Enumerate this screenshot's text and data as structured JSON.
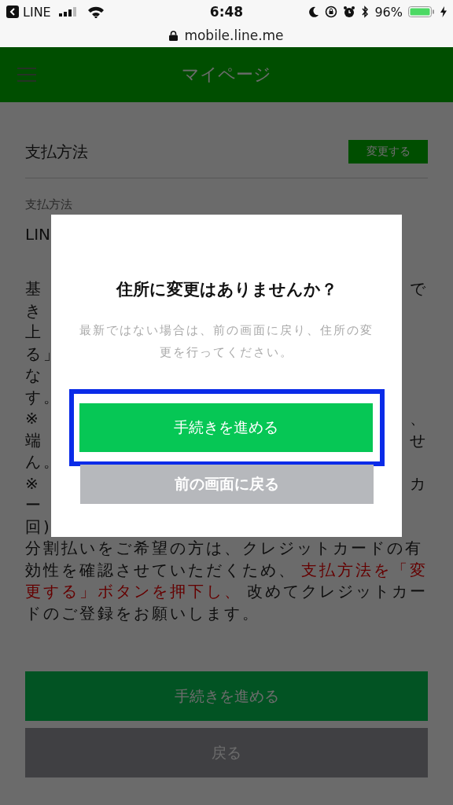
{
  "status_bar": {
    "back_app": "LINE",
    "time": "6:48",
    "battery": "96%"
  },
  "address_bar": {
    "url": "mobile.line.me"
  },
  "header": {
    "title": "マイページ"
  },
  "section": {
    "title": "支払方法",
    "change_button": "変更する"
  },
  "payment": {
    "label": "支払方法",
    "value": "LIN"
  },
  "notes_partial": [
    {
      "left": "基",
      "right": "で"
    },
    {
      "left": "き"
    },
    {
      "left": "上"
    },
    {
      "left": "る」"
    },
    {
      "left": "な"
    },
    {
      "left": "す。"
    },
    {
      "left": "※",
      "right": "、"
    },
    {
      "left": "端",
      "right": "せ"
    },
    {
      "left": "ん。"
    },
    {
      "left": "※",
      "right": "カ"
    },
    {
      "left": "ー"
    },
    {
      "left": "回)"
    }
  ],
  "notes": [
    [
      {
        "text": "分割払いをご希望の方は、クレジットカードの有",
        "emphasis": false
      }
    ],
    [
      {
        "text": "効性を確認させていただくため、",
        "emphasis": false
      },
      {
        "text": "支払方法を「変",
        "emphasis": true
      }
    ],
    [
      {
        "text": "更する」ボタンを押下し、",
        "emphasis": true
      },
      {
        "text": "改めてクレジットカー",
        "emphasis": false
      }
    ],
    [
      {
        "text": "ドのご登録をお願いします。",
        "emphasis": false
      }
    ]
  ],
  "buttons": [
    {
      "label": "手続きを進める",
      "kind": "primary"
    },
    {
      "label": "戻る",
      "kind": "secondary"
    }
  ],
  "dialog": {
    "title": "住所に変更はありませんか？",
    "message": "最新ではない場合は、前の画面に戻り、住所の変更を行ってください。",
    "buttons": [
      {
        "label": "手続きを進める",
        "kind": "primary",
        "highlighted": true
      },
      {
        "label": "前の画面に戻る",
        "kind": "secondary",
        "highlighted": false
      }
    ]
  }
}
